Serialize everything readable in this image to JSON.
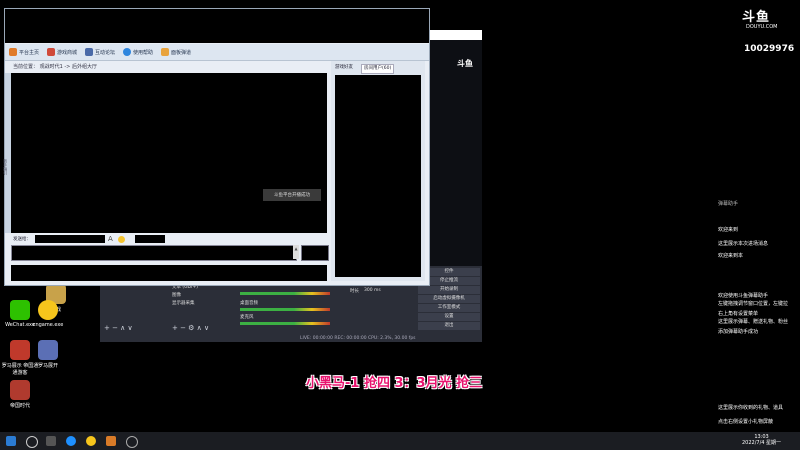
{
  "game": {
    "toolbar": [
      "平台主页",
      "游戏商城",
      "互动论坛",
      "使用帮助",
      "面板弹道"
    ],
    "breadcrumb": "当前位置： 观战时代1 -> 后外组大厅",
    "side_label": "新手指引",
    "notification": "斗鱼平台开播成功",
    "msg_label": "发送给：",
    "scroll_glyph": "▲",
    "panel_tabs": [
      "游戏好友",
      "房间用户(60)"
    ]
  },
  "obs": {
    "buttons": [
      "控件",
      "停止推流",
      "开始录制",
      "启动虚拟摄像机",
      "工作室模式",
      "设置",
      "退出"
    ],
    "sources": [
      "文本 (GDI+)",
      "图像",
      "显示器采集"
    ],
    "mixer": [
      "桌面音频",
      "麦克风"
    ],
    "duration_label": "时长",
    "duration_value": "300 ms",
    "status": "LIVE: 00:00:00   REC: 00:00:00   CPU: 2.3%, 30.00 fps",
    "controls": "+ − ∧ ∨",
    "source_controls": "+ − ⚙ ∧ ∨"
  },
  "overlay_text": "小黑马-1 抢四 3：3月光 抢三",
  "douyu": {
    "logo": "斗鱼",
    "site": "DOUYU.COM",
    "room_id": "10029976"
  },
  "chat": {
    "header": "弹幕助手",
    "items": [
      "欢迎来到",
      "这里展示本次进场消息",
      "欢迎来到本",
      "欢迎使用斗鱼弹幕助手",
      "左键拖拽调节窗口位置，左键拉",
      "右上角有设置菜单",
      "这里展示弹幕、赠送礼物、粉丝",
      "添加弹幕助手成功",
      "这里展示你收到的礼物、道具",
      "点击右侧设置小礼物屏蔽"
    ]
  },
  "desktop": {
    "icons": [
      "WeChat.exe",
      "cngame.exe",
      "游戏",
      "罗马展示 帝国通通游客",
      "罗马展开",
      "帝国时代"
    ]
  },
  "taskbar": {
    "time": "13:03",
    "date": "2022/7/4 星期一"
  }
}
